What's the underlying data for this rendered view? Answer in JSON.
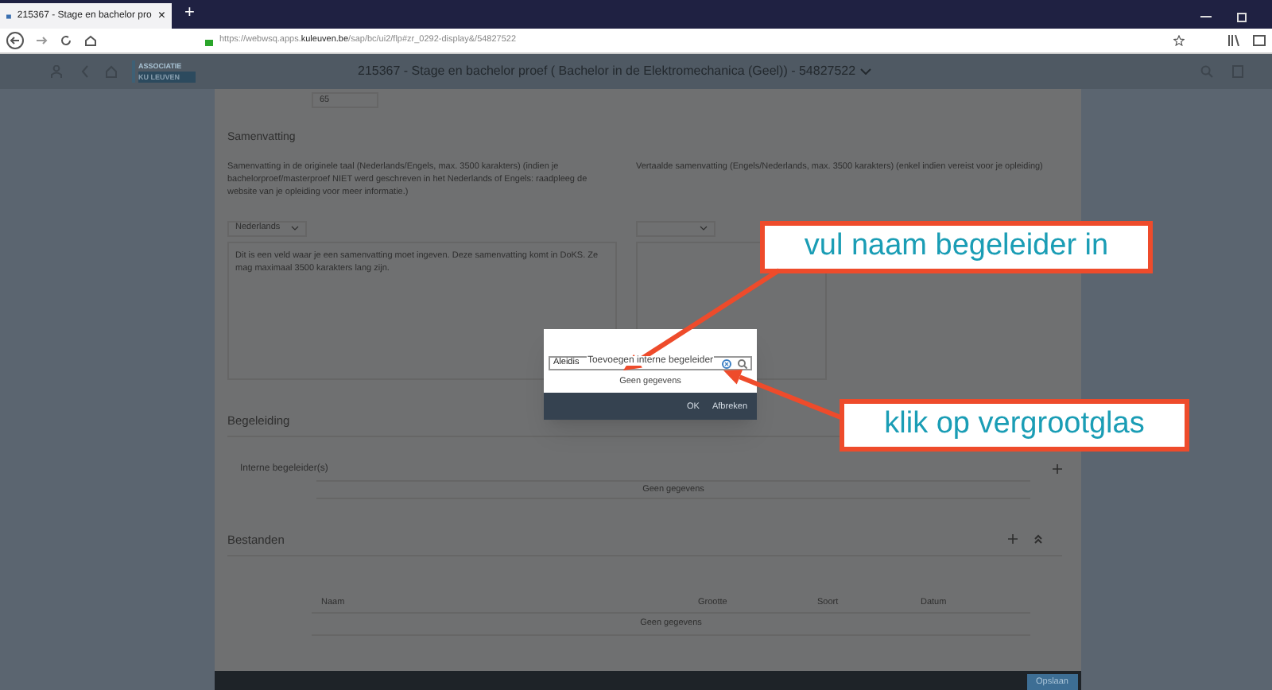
{
  "browser": {
    "tab": {
      "title": "215367 - Stage en bachelor pro",
      "close": "×"
    },
    "new_tab": "+",
    "address": "https://webwsq.apps.**kuleuven.be**/sap/bc/ui2/flp#zr_0292-display&/54827522"
  },
  "app_header": {
    "logo": [
      "ASSOCIATIE",
      "KU LEUVEN"
    ],
    "title": "215367 - Stage en bachelor proef ( Bachelor in de Elektromechanica (Geel)) - 54827522"
  },
  "form": {
    "top_field": "65",
    "summary_title": "Samenvatting",
    "original": {
      "label": "Samenvatting in de originele taal (Nederlands/Engels, max. 3500 karakters) (indien je bachelorproef/masterproef NIET werd geschreven in het Nederlands of Engels: raadpleeg de website van je opleiding voor meer informatie.)",
      "language": "Nederlands",
      "text": "Dit is een veld waar je een samenvatting moet ingeven.  Deze samenvatting komt in DoKS. Ze mag maximaal 3500 karakters lang zijn."
    },
    "translated": {
      "label": "Vertaalde samenvatting (Engels/Nederlands, max. 3500 karakters) (enkel indien vereist voor je opleiding)"
    },
    "begeleiding": {
      "title": "Begeleiding",
      "subtitle": "Interne begeleider(s)",
      "empty": "Geen gegevens"
    },
    "bestanden": {
      "title": "Bestanden",
      "columns": [
        "Naam",
        "Grootte",
        "Soort",
        "Datum"
      ],
      "empty": "Geen gegevens"
    },
    "save": "Opslaan"
  },
  "dialog": {
    "title": "Toevoegen interne begeleider",
    "value": "Aleidis",
    "empty": "Geen gegevens",
    "buttons": [
      "OK",
      "Afbreken"
    ]
  },
  "callouts": [
    "vul naam begeleider in",
    "klik op vergrootglas"
  ]
}
